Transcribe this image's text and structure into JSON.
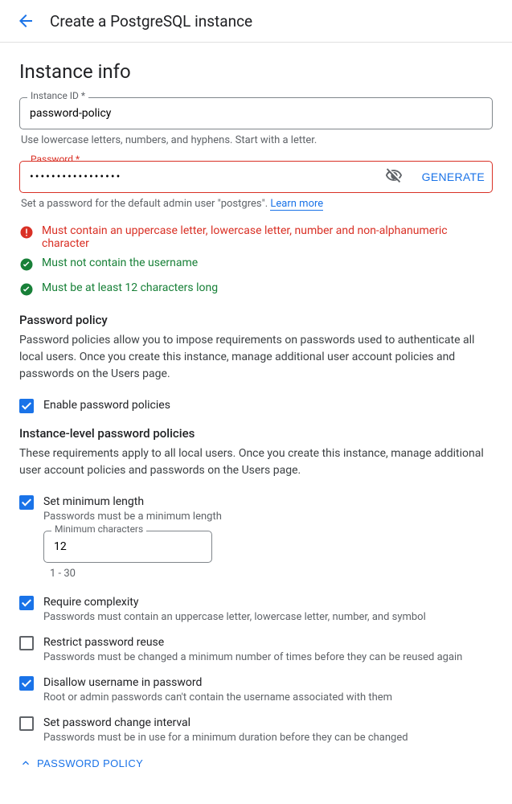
{
  "header": {
    "title": "Create a PostgreSQL instance"
  },
  "page": {
    "heading": "Instance info",
    "instance_id": {
      "label": "Instance ID *",
      "value": "password-policy",
      "hint": "Use lowercase letters, numbers, and hyphens. Start with a letter."
    },
    "password": {
      "label": "Password *",
      "value": "•••••••••••••••••",
      "generate_label": "GENERATE",
      "hint_prefix": "Set a password for the default admin user \"postgres\". ",
      "learn_more": "Learn more"
    },
    "rules": [
      {
        "status": "error",
        "text": "Must contain an uppercase letter, lowercase letter, number and non-alphanumeric character"
      },
      {
        "status": "ok",
        "text": "Must not contain the username"
      },
      {
        "status": "ok",
        "text": "Must be at least 12 characters long"
      }
    ],
    "policy": {
      "title": "Password policy",
      "desc": "Password policies allow you to impose requirements on passwords used to authenticate all local users. Once you create this instance, manage additional user account policies and passwords on the Users page.",
      "enable": {
        "checked": true,
        "label": "Enable password policies"
      },
      "instance_title": "Instance-level password policies",
      "instance_desc": "These requirements apply to all local users. Once you create this instance, manage additional user account policies and passwords on the Users page.",
      "items": [
        {
          "checked": true,
          "label": "Set minimum length",
          "desc": "Passwords must be a minimum length"
        },
        {
          "checked": true,
          "label": "Require complexity",
          "desc": "Passwords must contain an uppercase letter, lowercase letter, number, and symbol"
        },
        {
          "checked": false,
          "label": "Restrict password reuse",
          "desc": "Passwords must be changed a minimum number of times before they can be reused again"
        },
        {
          "checked": true,
          "label": "Disallow username in password",
          "desc": "Root or admin passwords can't contain the username associated with them"
        },
        {
          "checked": false,
          "label": "Set password change interval",
          "desc": "Passwords must be in use for a minimum duration before they can be changed"
        }
      ],
      "min_chars": {
        "label": "Minimum characters",
        "value": "12",
        "hint": "1 - 30"
      },
      "toggle_label": "PASSWORD POLICY"
    }
  }
}
